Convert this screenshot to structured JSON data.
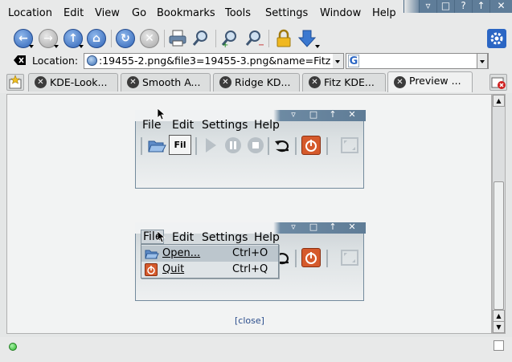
{
  "menubar": {
    "items": [
      "Location",
      "Edit",
      "View",
      "Go",
      "Bookmarks",
      "Tools",
      "Settings",
      "Window",
      "Help"
    ],
    "window_buttons": [
      "minimize",
      "maximize",
      "help",
      "shade",
      "close"
    ]
  },
  "toolbar": {
    "icons": [
      "back-icon",
      "forward-icon",
      "up-icon",
      "home-icon",
      "reload-icon",
      "stop-icon",
      "print-icon",
      "find-icon",
      "zoom-in-icon",
      "zoom-out-icon",
      "lock-icon",
      "download-icon",
      "konqueror-gear-icon"
    ]
  },
  "location_bar": {
    "label": "Location:",
    "value": ":19455-2.png&file3=19455-3.png&name=Fitz",
    "search_icon_letter": "G"
  },
  "tabs": [
    {
      "label": "KDE-Look...",
      "active": false
    },
    {
      "label": "Smooth A...",
      "active": false
    },
    {
      "label": "Ridge KD...",
      "active": false
    },
    {
      "label": "Fitz KDE...",
      "active": false
    },
    {
      "label": "Preview ...",
      "active": true
    }
  ],
  "preview": {
    "menu": [
      "File",
      "Edit",
      "Settings",
      "Help"
    ],
    "file_button_label": "Fil",
    "dropdown": [
      {
        "label": "Open...",
        "shortcut": "Ctrl+O"
      },
      {
        "label": "Quit",
        "shortcut": "Ctrl+Q"
      }
    ],
    "close_link": "[close]"
  },
  "colors": {
    "window_accent": "#5f7d99",
    "link": "#2b4d8c",
    "status_ok": "#2dbb2d"
  }
}
